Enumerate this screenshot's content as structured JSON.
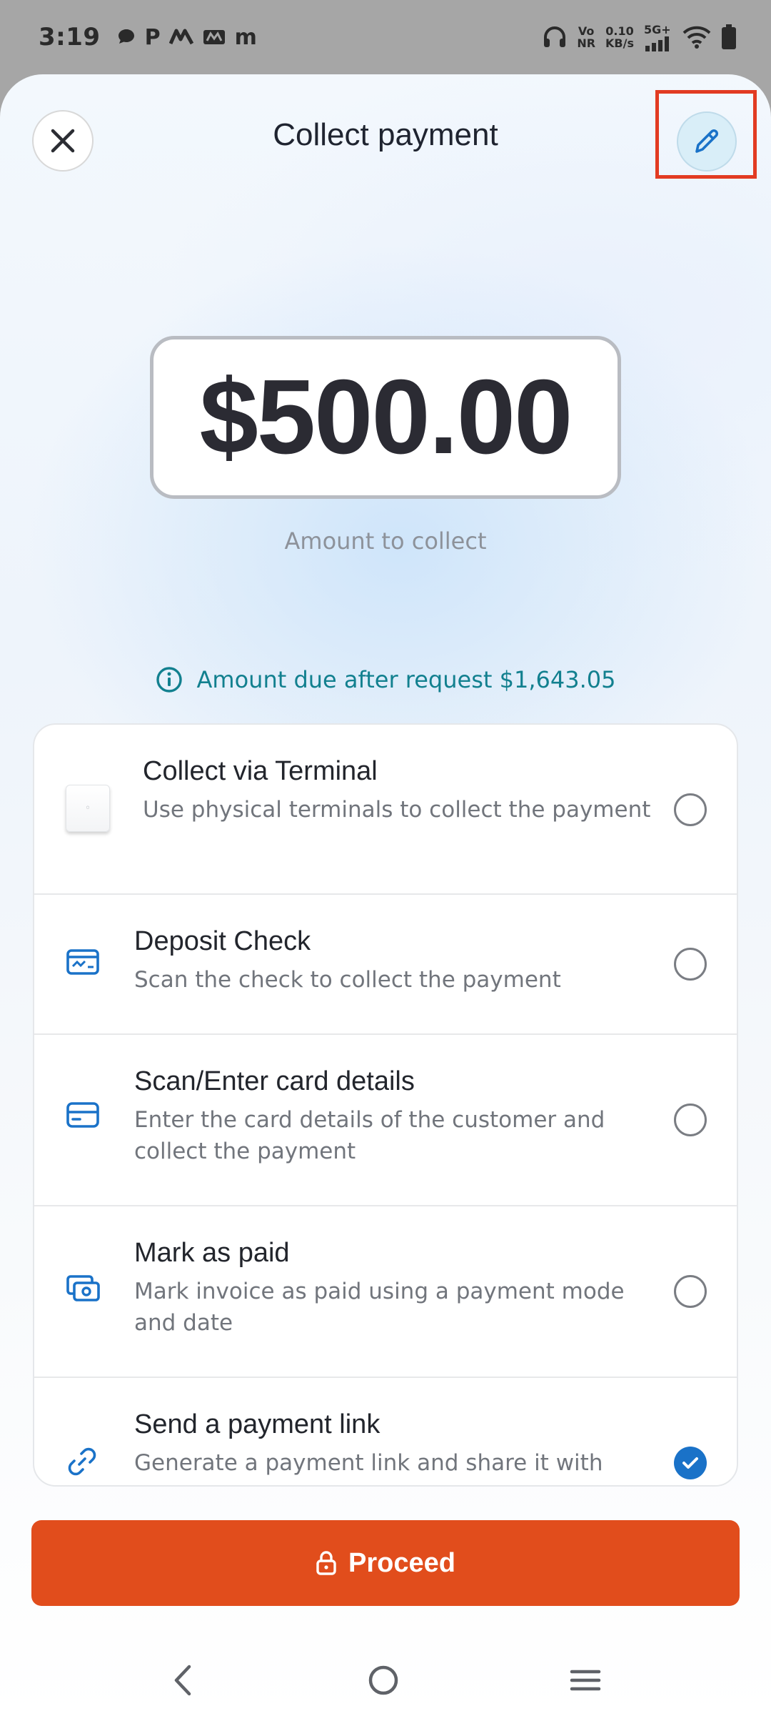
{
  "status_bar": {
    "time": "3:19",
    "app_icons": [
      "chat-bubble-icon",
      "P",
      "app-logo-icon",
      "app-logo-icon-2",
      "m"
    ],
    "network_line1": "Vo",
    "network_line2": "NR",
    "speed_line1": "0.10",
    "speed_line2": "KB/s",
    "signal_label": "5G+"
  },
  "header": {
    "title": "Collect payment",
    "close_icon": "close-icon",
    "edit_icon": "pencil-icon"
  },
  "amount": {
    "value": "$500.00",
    "label": "Amount to collect"
  },
  "due_info": {
    "text": "Amount due after request $1,643.05",
    "icon": "info-icon"
  },
  "options": [
    {
      "icon": "terminal-icon",
      "title": "Collect via Terminal",
      "description": "Use physical terminals to collect the payment",
      "selected": false
    },
    {
      "icon": "check-icon",
      "title": "Deposit Check",
      "description": "Scan the check to collect the payment",
      "selected": false
    },
    {
      "icon": "card-icon",
      "title": "Scan/Enter card details",
      "description": "Enter the card details of the customer and collect the payment",
      "selected": false
    },
    {
      "icon": "cash-icon",
      "title": "Mark as paid",
      "description": "Mark invoice as paid using a payment mode and date",
      "selected": false
    },
    {
      "icon": "link-icon",
      "title": "Send a payment link",
      "description": "Generate a payment link and share it with",
      "selected": true
    }
  ],
  "proceed": {
    "label": "Proceed",
    "icon": "lock-icon"
  },
  "nav": {
    "back_icon": "back-icon",
    "home_icon": "home-icon",
    "menu_icon": "menu-icon"
  },
  "colors": {
    "accent_teal": "#12808f",
    "primary_blue": "#1a72c8",
    "proceed_orange": "#e14d1c",
    "highlight_red": "#e23b22"
  }
}
